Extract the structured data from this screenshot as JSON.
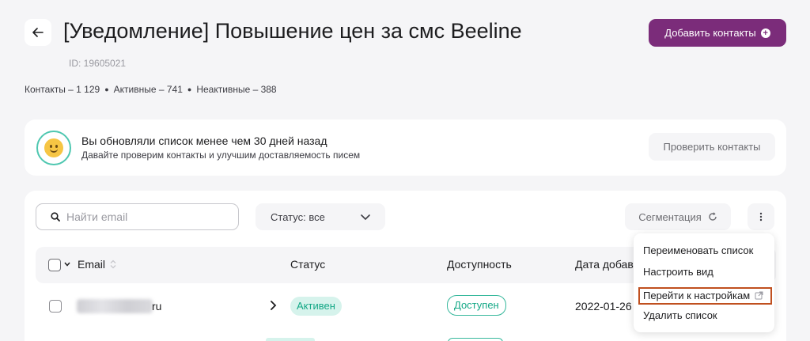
{
  "header": {
    "title": "[Уведомление] Повышение цен за смс Beeline",
    "list_id": "ID: 19605021",
    "add_contacts_label": "Добавить контакты",
    "accent_color": "#7b2c7a"
  },
  "stats": {
    "contacts": "Контакты – 1 129",
    "active": "Активные – 741",
    "inactive": "Неактивные – 388"
  },
  "banner": {
    "title": "Вы обновляли список менее чем 30 дней назад",
    "subtitle": "Давайте проверим контакты и улучшим доставляемость писем",
    "button_label": "Проверить контакты",
    "icon": "smile-icon"
  },
  "toolbar": {
    "search_placeholder": "Найти email",
    "status_filter_label": "Статус: все",
    "segmentation_label": "Сегментация"
  },
  "table": {
    "columns": [
      "Email",
      "Статус",
      "Доступность",
      "Дата добав"
    ],
    "rows": [
      {
        "email_visible_suffix": "ru",
        "status": "Активен",
        "availability": "Доступен",
        "date": "2022-01-26"
      }
    ]
  },
  "menu": {
    "items": [
      "Переименовать список",
      "Настроить вид",
      "Перейти к настройкам",
      "Удалить список"
    ],
    "highlight_color": "#c0501f"
  },
  "status_colors": {
    "active_bg": "#d6f3ec",
    "active_text": "#14a886"
  }
}
